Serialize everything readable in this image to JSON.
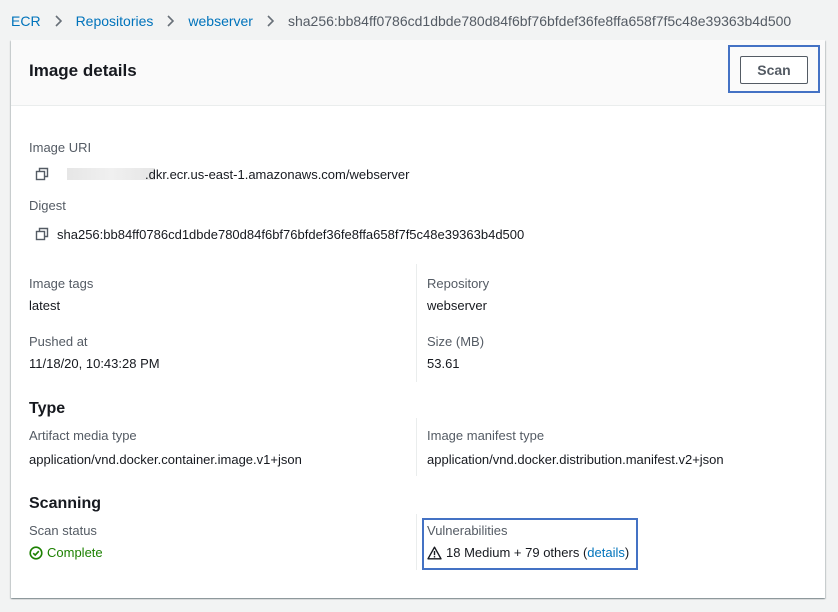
{
  "breadcrumb": {
    "items": [
      "ECR",
      "Repositories",
      "webserver"
    ],
    "current": "sha256:bb84ff0786cd1dbde780d84f6bf76bfdef36fe8ffa658f7f5c48e39363b4d500"
  },
  "panel": {
    "title": "Image details",
    "scan_label": "Scan"
  },
  "details": {
    "image_uri_label": "Image URI",
    "image_uri_value": ".dkr.ecr.us-east-1.amazonaws.com/webserver",
    "digest_label": "Digest",
    "digest_value": "sha256:bb84ff0786cd1dbde780d84f6bf76bfdef36fe8ffa658f7f5c48e39363b4d500",
    "image_tags_label": "Image tags",
    "image_tags_value": "latest",
    "repository_label": "Repository",
    "repository_value": "webserver",
    "pushed_at_label": "Pushed at",
    "pushed_at_value": "11/18/20, 10:43:28 PM",
    "size_label": "Size (MB)",
    "size_value": "53.61"
  },
  "type": {
    "title": "Type",
    "artifact_label": "Artifact media type",
    "artifact_value": "application/vnd.docker.container.image.v1+json",
    "manifest_label": "Image manifest type",
    "manifest_value": "application/vnd.docker.distribution.manifest.v2+json"
  },
  "scanning": {
    "title": "Scanning",
    "status_label": "Scan status",
    "status_value": "Complete",
    "vuln_label": "Vulnerabilities",
    "vuln_summary": "18 Medium + 79 others (",
    "vuln_link": "details",
    "vuln_close": ")"
  },
  "colors": {
    "link": "#0073bb",
    "success": "#1d8102",
    "highlight": "#4472c4"
  }
}
